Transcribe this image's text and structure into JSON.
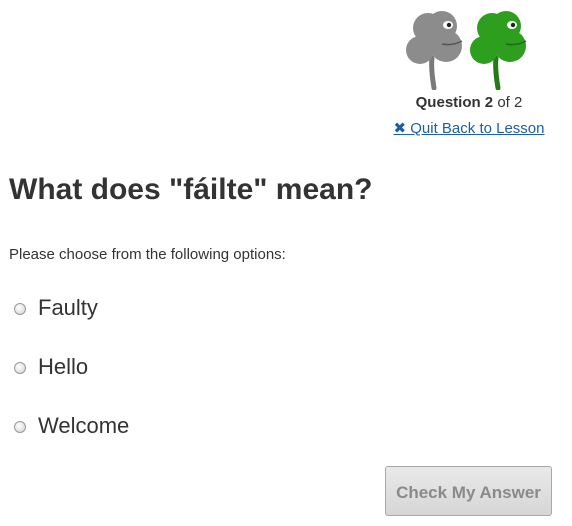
{
  "progress": {
    "question_label": "Question 2",
    "of_text": "of 2",
    "questions_total": 2,
    "questions_answered": 1,
    "clover_colors": {
      "done": "#8c8c8c",
      "current": "#2e9e1f"
    },
    "clover_icons": [
      "shamrock-icon",
      "shamrock-icon"
    ],
    "quit_icon": "✖",
    "quit_label": "Quit Back to Lesson"
  },
  "question": {
    "title": "What does \"fáilte\" mean?",
    "instructions": "Please choose from the following options:",
    "options": [
      {
        "label": "Faulty",
        "selected": false
      },
      {
        "label": "Hello",
        "selected": false
      },
      {
        "label": "Welcome",
        "selected": false
      }
    ]
  },
  "actions": {
    "check_label": "Check My Answer"
  },
  "colors": {
    "link": "#1a5fa8",
    "text": "#333333",
    "button_text_disabled": "#8a8a8a"
  }
}
